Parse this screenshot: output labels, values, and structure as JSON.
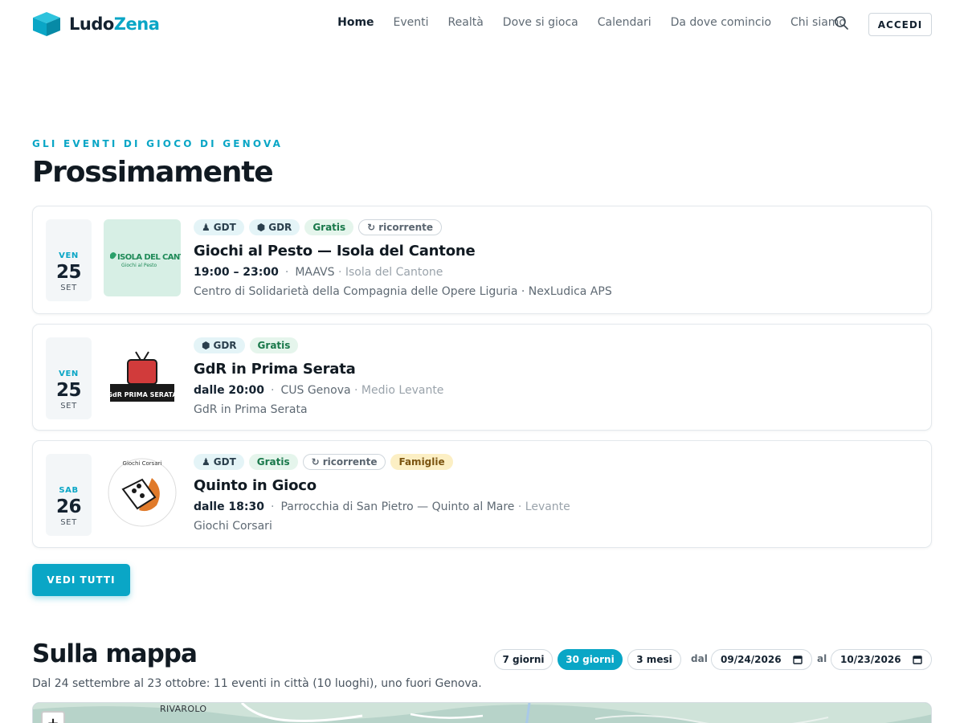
{
  "brand": {
    "name_part1": "Ludo",
    "name_part2": "Zena",
    "accent_color": "#0aa6c6"
  },
  "nav": {
    "items": [
      {
        "label": "Home",
        "active": true
      },
      {
        "label": "Eventi"
      },
      {
        "label": "Realtà"
      },
      {
        "label": "Dove si gioca"
      },
      {
        "label": "Calendari"
      },
      {
        "label": "Da dove comincio"
      },
      {
        "label": "Chi siamo"
      }
    ],
    "search_icon": "search-icon",
    "login_label": "ACCEDI"
  },
  "upcoming": {
    "kicker": "GLI EVENTI DI GIOCO DI GENOVA",
    "title": "Prossimamente",
    "events": [
      {
        "dow": "VEN",
        "day": "25",
        "month": "SET",
        "thumb_text": "ISOLA DEL CANTONE",
        "thumb_subtext": "Giochi al Pesto",
        "tags": [
          "GDT",
          "GDR",
          "Gratis",
          "ricorrente"
        ],
        "title": "Giochi al Pesto — Isola del Cantone",
        "time": "19:00 – 23:00",
        "place": "MAAVS",
        "area": "· Isola del Cantone",
        "organizer": "Centro di Solidarietà della Compagnia delle Opere Liguria · NexLudica APS"
      },
      {
        "dow": "VEN",
        "day": "25",
        "month": "SET",
        "thumb_text": "GdR PRIMA SERATA",
        "tags": [
          "GDR",
          "Gratis"
        ],
        "title": "GdR in Prima Serata",
        "time": "dalle 20:00",
        "place": "CUS Genova",
        "area": "· Medio Levante",
        "organizer": "GdR in Prima Serata"
      },
      {
        "dow": "SAB",
        "day": "26",
        "month": "SET",
        "thumb_text": "Giochi Corsari",
        "tags": [
          "GDT",
          "Gratis",
          "ricorrente",
          "Famiglie"
        ],
        "title": "Quinto in Gioco",
        "time": "dalle 18:30",
        "place": "Parrocchia di San Pietro — Quinto al Mare",
        "area": "· Levante",
        "organizer": "Giochi Corsari"
      }
    ],
    "see_all_label": "VEDI TUTTI"
  },
  "map_section": {
    "title": "Sulla mappa",
    "subtitle": "Dal 24 settembre al 23 ottobre: 11 eventi in città (10 luoghi), uno fuori Genova.",
    "ranges": [
      "7 giorni",
      "30 giorni",
      "3 mesi"
    ],
    "active_range": "30 giorni",
    "from_label": "dal",
    "from_value": "09/24/2026",
    "to_label": "al",
    "to_value": "10/23/2026",
    "map_label": "RIVAROLO",
    "zoom_in_label": "+"
  }
}
